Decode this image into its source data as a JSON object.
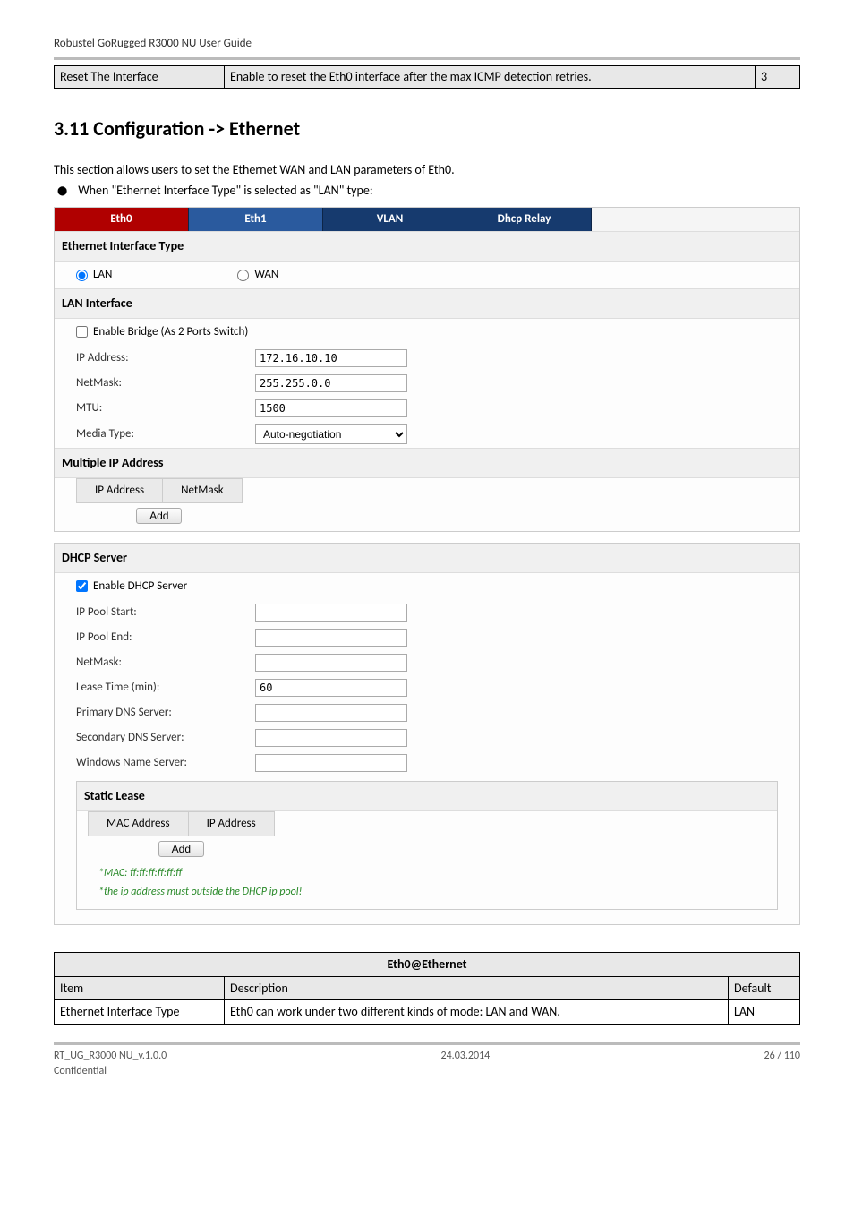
{
  "header": {
    "title": "Robustel GoRugged R3000 NU User Guide"
  },
  "top_table": {
    "col1": "Reset The Interface",
    "col2": "Enable to reset the Eth0 interface after the max ICMP detection retries.",
    "col3": "3"
  },
  "section": {
    "heading": "3.11  Configuration -> Ethernet",
    "intro": "This section allows users to set the Ethernet WAN and LAN parameters of Eth0.",
    "bullet": "When \"Ethernet Interface Type\" is selected as \"LAN\" type:"
  },
  "tabs": [
    "Eth0",
    "Eth1",
    "VLAN",
    "Dhcp Relay"
  ],
  "eth_interface_type": {
    "header": "Ethernet Interface Type",
    "options": {
      "lan": "LAN",
      "wan": "WAN"
    }
  },
  "lan_interface": {
    "header": "LAN Interface",
    "bridge_label": "Enable Bridge (As 2 Ports Switch)",
    "ip_label": "IP Address:",
    "ip_value": "172.16.10.10",
    "netmask_label": "NetMask:",
    "netmask_value": "255.255.0.0",
    "mtu_label": "MTU:",
    "mtu_value": "1500",
    "media_label": "Media Type:",
    "media_value": "Auto-negotiation"
  },
  "multiple_ip": {
    "header": "Multiple IP Address",
    "col_ip": "IP Address",
    "col_mask": "NetMask",
    "add": "Add"
  },
  "dhcp": {
    "header": "DHCP Server",
    "enable": "Enable DHCP Server",
    "pool_start": "IP Pool Start:",
    "pool_end": "IP Pool End:",
    "netmask": "NetMask:",
    "lease": "Lease Time (min):",
    "lease_value": "60",
    "primary_dns": "Primary DNS Server:",
    "secondary_dns": "Secondary DNS Server:",
    "wins": "Windows Name Server:"
  },
  "static_lease": {
    "header": "Static Lease",
    "col_mac": "MAC Address",
    "col_ip": "IP Address",
    "add": "Add",
    "hint_mac": "*MAC: ff:ff:ff:ff:ff:ff",
    "hint_ip": "*the ip address must outside the DHCP ip pool!"
  },
  "desc_table": {
    "title": "Eth0@Ethernet",
    "head": {
      "item": "Item",
      "desc": "Description",
      "default": "Default"
    },
    "row1": {
      "item": "Ethernet Interface Type",
      "desc": "Eth0 can work under two different kinds of mode: LAN and WAN.",
      "default": "LAN"
    }
  },
  "footer": {
    "left1": "RT_UG_R3000 NU_v.1.0.0",
    "left2": "Confidential",
    "center": "24.03.2014",
    "right": "26 / 110"
  }
}
